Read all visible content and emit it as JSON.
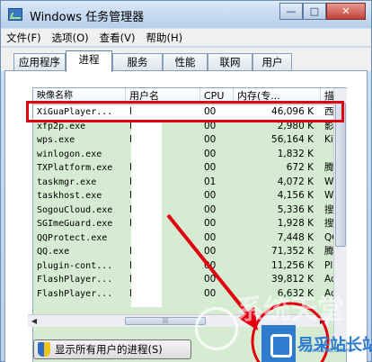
{
  "window": {
    "title": "Windows 任务管理器",
    "controls": {
      "minimize": "—",
      "maximize": "□",
      "close": "✕"
    }
  },
  "menu": [
    "文件(F)",
    "选项(O)",
    "查看(V)",
    "帮助(H)"
  ],
  "tabs": [
    "应用程序",
    "进程",
    "服务",
    "性能",
    "联网",
    "用户"
  ],
  "active_tab": "进程",
  "columns": [
    "映像名称",
    "用户名",
    "CPU",
    "内存(专...",
    "描述"
  ],
  "processes": [
    {
      "name": "XiGuaPlayer...",
      "user": "h",
      "cpu": "00",
      "mem": "46,096 K",
      "desc": "西瓜影"
    },
    {
      "name": "xfp2p.exe",
      "user": "h",
      "cpu": "00",
      "mem": "2,980 K",
      "desc": "影音先"
    },
    {
      "name": "wps.exe",
      "user": "h",
      "cpu": "00",
      "mem": "56,164 K",
      "desc": "Kings"
    },
    {
      "name": "winlogon.exe",
      "user": "",
      "cpu": "00",
      "mem": "1,832 K",
      "desc": ""
    },
    {
      "name": "TXPlatform.exe",
      "user": "h",
      "cpu": "00",
      "mem": "672 K",
      "desc": "腾讯Q"
    },
    {
      "name": "taskmgr.exe",
      "user": "h",
      "cpu": "01",
      "mem": "4,072 K",
      "desc": "Windo"
    },
    {
      "name": "taskhost.exe",
      "user": "h",
      "cpu": "00",
      "mem": "4,156 K",
      "desc": "Windo"
    },
    {
      "name": "SogouCloud.exe",
      "user": "h",
      "cpu": "00",
      "mem": "5,336 K",
      "desc": "搜狗输"
    },
    {
      "name": "SGImeGuard.exe",
      "user": "h",
      "cpu": "00",
      "mem": "1,928 K",
      "desc": "搜狗输"
    },
    {
      "name": "QQProtect.exe",
      "user": "",
      "cpu": "00",
      "mem": "7,448 K",
      "desc": "QQ安全"
    },
    {
      "name": "QQ.exe",
      "user": "h",
      "cpu": "00",
      "mem": "71,352 K",
      "desc": "腾讯Q"
    },
    {
      "name": "plugin-cont...",
      "user": "h",
      "cpu": "00",
      "mem": "11,256 K",
      "desc": "Plugi"
    },
    {
      "name": "FlashPlayer...",
      "user": "h",
      "cpu": "00",
      "mem": "39,812 K",
      "desc": "Adobe"
    },
    {
      "name": "FlashPlayer...",
      "user": "h",
      "cpu": "00",
      "mem": "6,632 K",
      "desc": "Adobe"
    }
  ],
  "show_all_button": "显示所有用户的进程(S)",
  "watermark": {
    "brand": "易采站长站",
    "faint": "系统天堂",
    "sub": "Www.Easck.Com"
  }
}
